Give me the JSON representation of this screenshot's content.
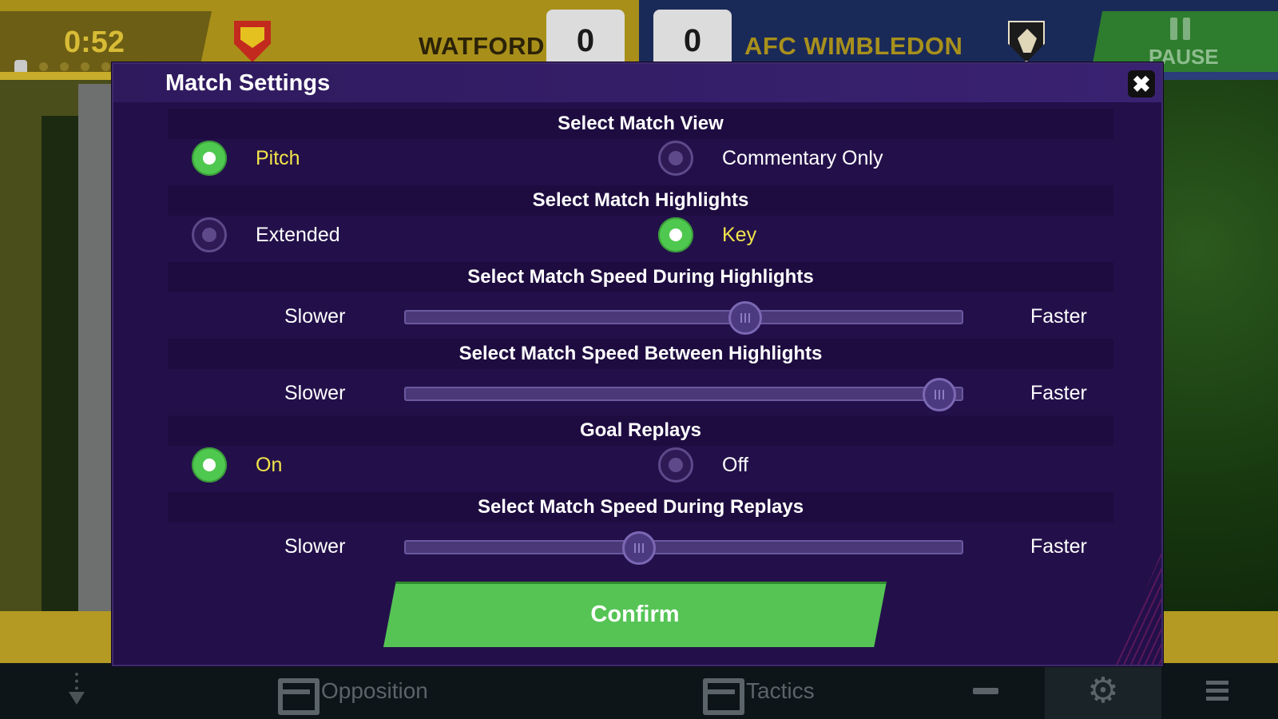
{
  "scoreboard": {
    "clock": "0:52",
    "home_team": "WATFORD",
    "home_score": "0",
    "away_score": "0",
    "away_team": "AFC WIMBLEDON",
    "pause_label": "PAUSE"
  },
  "modal": {
    "title": "Match Settings",
    "close_icon": "close-icon",
    "sections": {
      "match_view": {
        "title": "Select Match View",
        "options": [
          {
            "label": "Pitch",
            "selected": true
          },
          {
            "label": "Commentary Only",
            "selected": false
          }
        ]
      },
      "highlights": {
        "title": "Select Match Highlights",
        "options": [
          {
            "label": "Extended",
            "selected": false
          },
          {
            "label": "Key",
            "selected": true
          }
        ]
      },
      "speed_during_highlights": {
        "title": "Select Match Speed During Highlights",
        "min_label": "Slower",
        "max_label": "Faster",
        "value": 0.61
      },
      "speed_between_highlights": {
        "title": "Select Match Speed Between Highlights",
        "min_label": "Slower",
        "max_label": "Faster",
        "value": 0.96
      },
      "goal_replays": {
        "title": "Goal Replays",
        "options": [
          {
            "label": "On",
            "selected": true
          },
          {
            "label": "Off",
            "selected": false
          }
        ]
      },
      "speed_during_replays": {
        "title": "Select Match Speed During Replays",
        "min_label": "Slower",
        "max_label": "Faster",
        "value": 0.42
      }
    },
    "confirm_label": "Confirm"
  },
  "bottom_nav": {
    "opposition_label": "Opposition",
    "tactics_label": "Tactics",
    "icons": [
      "substitutions-icon",
      "opposition-board-icon",
      "tactics-board-icon",
      "minus-icon",
      "gear-icon",
      "menu-icon"
    ]
  },
  "colors": {
    "home": "#a88f1a",
    "away": "#1a2a58",
    "modal_bg": "#23104a",
    "accent_green": "#55c455",
    "active_label": "#f2e44a"
  }
}
